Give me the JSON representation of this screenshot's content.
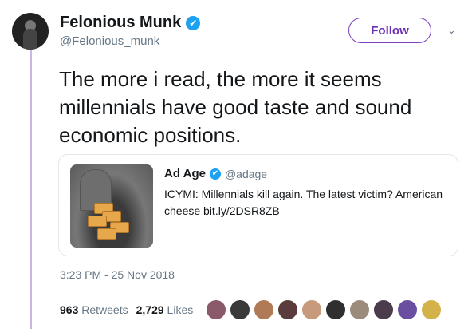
{
  "author": {
    "display_name": "Felonious Munk",
    "handle": "@Felonious_munk",
    "verified_glyph": "✔"
  },
  "follow_label": "Follow",
  "chevron_glyph": "⌄",
  "tweet_text": "The more i read, the more it seems millennials have good taste and sound economic positions.",
  "quote": {
    "name": "Ad Age",
    "handle": "@adage",
    "verified_glyph": "✔",
    "text": "ICYMI: Millennials kill again. The latest victim? American cheese bit.ly/2DSR8ZB"
  },
  "timestamp": "3:23 PM - 25 Nov 2018",
  "stats": {
    "retweets_count": "963",
    "retweets_label": "Retweets",
    "likes_count": "2,729",
    "likes_label": "Likes"
  },
  "colors": {
    "follow_border": "#7d3fbf",
    "verified": "#1da1f2",
    "thread_line": "#c7b6e6"
  },
  "liker_colors": [
    "#8b5a6a",
    "#3a3a3a",
    "#b07a56",
    "#5b3c3c",
    "#c69a7a",
    "#2f2f2f",
    "#9a8b7a",
    "#4b3b4b",
    "#6a4fa0",
    "#d4b24a"
  ]
}
